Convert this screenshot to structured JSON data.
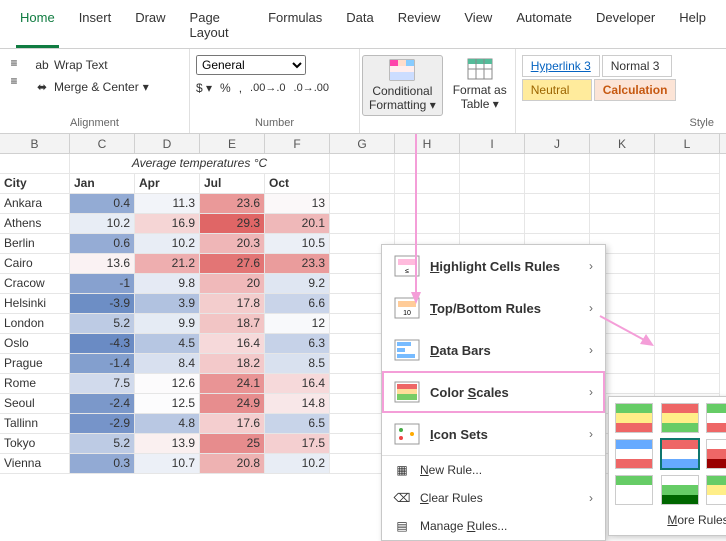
{
  "tabs": [
    "Home",
    "Insert",
    "Draw",
    "Page Layout",
    "Formulas",
    "Data",
    "Review",
    "View",
    "Automate",
    "Developer",
    "Help"
  ],
  "active_tab": "Home",
  "ribbon": {
    "wrap_text": "Wrap Text",
    "merge_center": "Merge & Center",
    "alignment_label": "Alignment",
    "number_format": "General",
    "number_label": "Number",
    "cond_fmt_line1": "Conditional",
    "cond_fmt_line2": "Formatting",
    "fmt_table_line1": "Format as",
    "fmt_table_line2": "Table",
    "styles": {
      "a": "Hyperlink 3",
      "b": "Normal 3",
      "c": "Neutral",
      "d": "Calculation"
    },
    "style_label": "Style"
  },
  "cf_menu": {
    "highlight": "ighlight Cells Rules",
    "highlight_pre": "H",
    "topbottom": "op/Bottom Rules",
    "topbottom_pre": "T",
    "databars": "ata Bars",
    "databars_pre": "D",
    "colorscales": "Color ",
    "colorscales_u": "S",
    "colorscales_post": "cales",
    "iconsets": "con Sets",
    "iconsets_pre": "I",
    "newrule": "ew Rule...",
    "newrule_pre": "N",
    "clear": "lear Rules",
    "clear_pre": "C",
    "manage": "Manage ",
    "manage_u": "R",
    "manage_post": "ules..."
  },
  "cs_more": "More Rules...",
  "cs_more_u": "M",
  "columns": [
    "B",
    "C",
    "D",
    "E",
    "F",
    "G",
    "H",
    "I",
    "J",
    "K",
    "L"
  ],
  "title": "Average temperatures °C",
  "headers": [
    "City",
    "Jan",
    "Apr",
    "Jul",
    "Oct"
  ],
  "rows": [
    {
      "city": "Ankara",
      "v": [
        "0.4",
        "11.3",
        "23.6",
        "13"
      ]
    },
    {
      "city": "Athens",
      "v": [
        "10.2",
        "16.9",
        "29.3",
        "20.1"
      ]
    },
    {
      "city": "Berlin",
      "v": [
        "0.6",
        "10.2",
        "20.3",
        "10.5"
      ]
    },
    {
      "city": "Cairo",
      "v": [
        "13.6",
        "21.2",
        "27.6",
        "23.3"
      ]
    },
    {
      "city": "Cracow",
      "v": [
        "-1",
        "9.8",
        "20",
        "9.2"
      ]
    },
    {
      "city": "Helsinki",
      "v": [
        "-3.9",
        "3.9",
        "17.8",
        "6.6"
      ]
    },
    {
      "city": "London",
      "v": [
        "5.2",
        "9.9",
        "18.7",
        "12"
      ]
    },
    {
      "city": "Oslo",
      "v": [
        "-4.3",
        "4.5",
        "16.4",
        "6.3"
      ]
    },
    {
      "city": "Prague",
      "v": [
        "-1.4",
        "8.4",
        "18.2",
        "8.5"
      ]
    },
    {
      "city": "Rome",
      "v": [
        "7.5",
        "12.6",
        "24.1",
        "16.4"
      ]
    },
    {
      "city": "Seoul",
      "v": [
        "-2.4",
        "12.5",
        "24.9",
        "14.8"
      ]
    },
    {
      "city": "Tallinn",
      "v": [
        "-2.9",
        "4.8",
        "17.6",
        "6.5"
      ]
    },
    {
      "city": "Tokyo",
      "v": [
        "5.2",
        "13.9",
        "25",
        "17.5"
      ]
    },
    {
      "city": "Vienna",
      "v": [
        "0.3",
        "10.7",
        "20.8",
        "10.2"
      ]
    }
  ],
  "chart_data": {
    "type": "heatmap",
    "title": "Average temperatures °C",
    "categories_y": [
      "Ankara",
      "Athens",
      "Berlin",
      "Cairo",
      "Cracow",
      "Helsinki",
      "London",
      "Oslo",
      "Prague",
      "Rome",
      "Seoul",
      "Tallinn",
      "Tokyo",
      "Vienna"
    ],
    "categories_x": [
      "Jan",
      "Apr",
      "Jul",
      "Oct"
    ],
    "values": [
      [
        0.4,
        11.3,
        23.6,
        13
      ],
      [
        10.2,
        16.9,
        29.3,
        20.1
      ],
      [
        0.6,
        10.2,
        20.3,
        10.5
      ],
      [
        13.6,
        21.2,
        27.6,
        23.3
      ],
      [
        -1,
        9.8,
        20,
        9.2
      ],
      [
        -3.9,
        3.9,
        17.8,
        6.6
      ],
      [
        5.2,
        9.9,
        18.7,
        12
      ],
      [
        -4.3,
        4.5,
        16.4,
        6.3
      ],
      [
        -1.4,
        8.4,
        18.2,
        8.5
      ],
      [
        7.5,
        12.6,
        24.1,
        16.4
      ],
      [
        -2.4,
        12.5,
        24.9,
        14.8
      ],
      [
        -2.9,
        4.8,
        17.6,
        6.5
      ],
      [
        5.2,
        13.9,
        25,
        17.5
      ],
      [
        0.3,
        10.7,
        20.8,
        10.2
      ]
    ],
    "color_scale": {
      "low": "#6a8bc4",
      "mid": "#fcfcfd",
      "high": "#e06666"
    },
    "range": [
      -4.3,
      29.3
    ]
  }
}
